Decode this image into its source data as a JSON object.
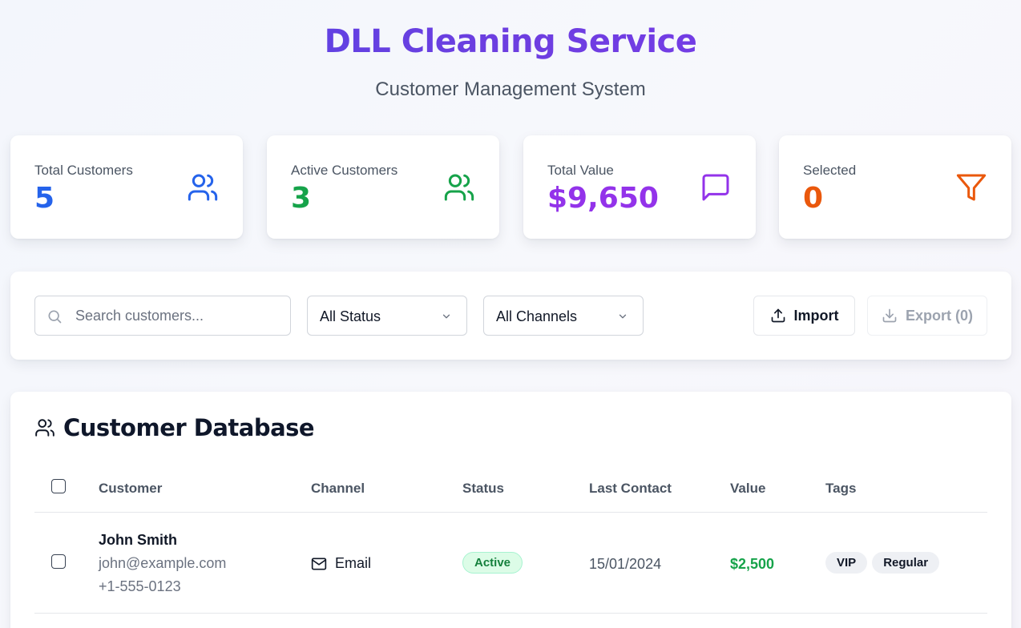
{
  "header": {
    "title": "DLL Cleaning Service",
    "subtitle": "Customer Management System"
  },
  "stats": [
    {
      "label": "Total Customers",
      "value": "5",
      "color": "#2563eb",
      "icon": "users-icon"
    },
    {
      "label": "Active Customers",
      "value": "3",
      "color": "#16a34a",
      "icon": "users-icon"
    },
    {
      "label": "Total Value",
      "value": "$9,650",
      "color": "#9333ea",
      "icon": "message-square-icon"
    },
    {
      "label": "Selected",
      "value": "0",
      "color": "#ea580c",
      "icon": "filter-icon"
    }
  ],
  "filters": {
    "search_placeholder": "Search customers...",
    "status_selected": "All Status",
    "channel_selected": "All Channels",
    "import_label": "Import",
    "export_label": "Export (0)"
  },
  "table": {
    "title": "Customer Database",
    "columns": [
      "Customer",
      "Channel",
      "Status",
      "Last Contact",
      "Value",
      "Tags"
    ],
    "rows": [
      {
        "name": "John Smith",
        "email": "john@example.com",
        "phone": "+1-555-0123",
        "channel": "Email",
        "status": "Active",
        "last_contact": "15/01/2024",
        "value": "$2,500",
        "tags": [
          "VIP",
          "Regular"
        ]
      }
    ]
  }
}
